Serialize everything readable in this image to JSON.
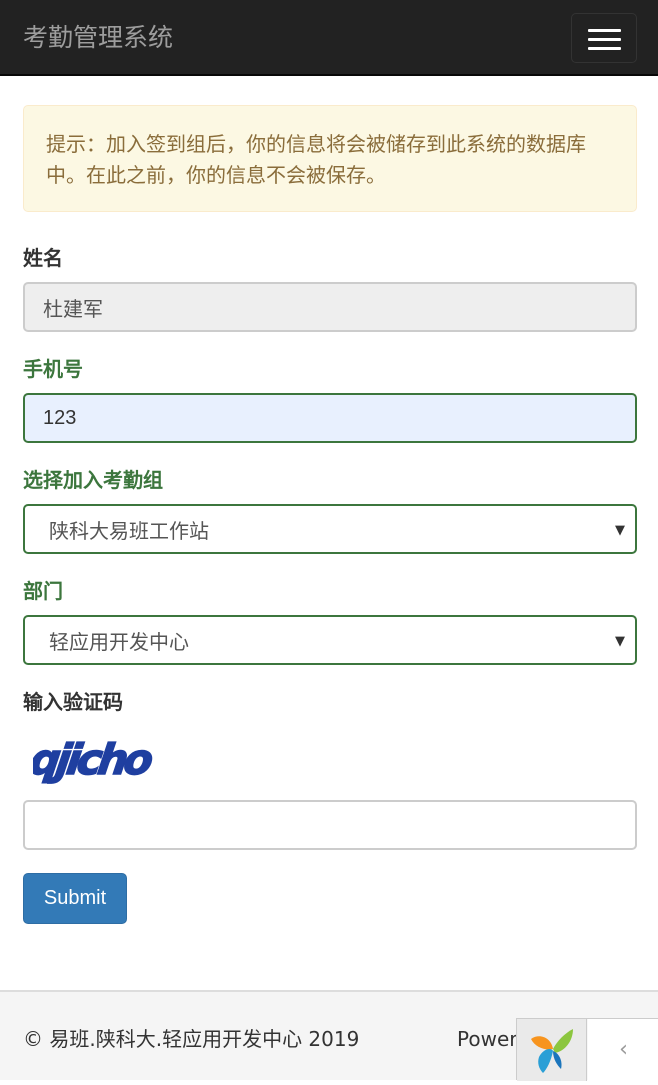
{
  "navbar": {
    "brand": "考勤管理系统",
    "menu_icon": "hamburger-menu-icon"
  },
  "alert": {
    "text": "提示：加入签到组后，你的信息将会被储存到此系统的数据库中。在此之前，你的信息不会被保存。"
  },
  "form": {
    "name_label": "姓名",
    "name_value": "杜建军",
    "phone_label": "手机号",
    "phone_value": "123",
    "group_label": "选择加入考勤组",
    "group_selected": "陕科大易班工作站",
    "dept_label": "部门",
    "dept_selected": "轻应用开发中心",
    "captcha_label": "输入验证码",
    "captcha_text": "qjicho",
    "captcha_value": "",
    "submit_label": "Submit"
  },
  "footer": {
    "copyright": "© 易班.陕科大.轻应用开发中心 2019",
    "powered": "Powered by"
  },
  "debug_toolbar": {
    "logo_icon": "yii-logo-icon",
    "collapse_icon": "chevron-left-icon"
  },
  "colors": {
    "navbar_bg": "#222222",
    "alert_bg": "#fcf8e3",
    "success_green": "#3c763d",
    "primary_button": "#337ab7"
  }
}
